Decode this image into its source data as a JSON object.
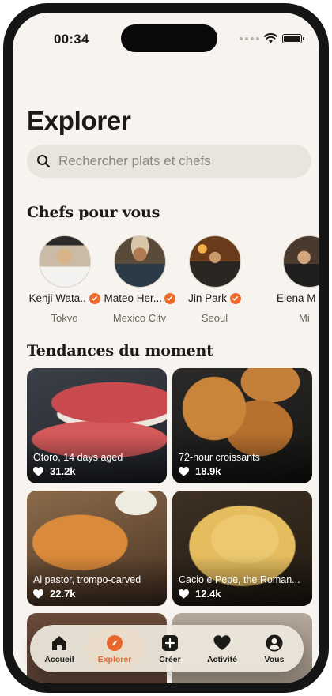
{
  "status_bar": {
    "time": "00:34"
  },
  "page": {
    "title": "Explorer"
  },
  "search": {
    "placeholder": "Rechercher plats et chefs"
  },
  "chefs_section": {
    "heading": "Chefs pour vous",
    "chefs": [
      {
        "name": "Kenji Wata...",
        "city": "Tokyo"
      },
      {
        "name": "Mateo Her...",
        "city": "Mexico City"
      },
      {
        "name": "Jin Park",
        "city": "Seoul"
      },
      {
        "name": "Elena M",
        "city": "Mi"
      }
    ]
  },
  "trending_section": {
    "heading": "Tendances du moment",
    "cards": [
      {
        "title": "Otoro, 14 days aged",
        "likes": "31.2k"
      },
      {
        "title": "72-hour croissants",
        "likes": "18.9k"
      },
      {
        "title": "Al pastor, trompo-carved",
        "likes": "22.7k"
      },
      {
        "title": "Cacio e Pepe, the Roman...",
        "likes": "12.4k"
      }
    ]
  },
  "tab_bar": {
    "tabs": [
      {
        "label": "Accueil",
        "icon": "home-icon"
      },
      {
        "label": "Explorer",
        "icon": "compass-icon",
        "active": true
      },
      {
        "label": "Créer",
        "icon": "plus-square-icon"
      },
      {
        "label": "Activité",
        "icon": "heart-icon"
      },
      {
        "label": "Vous",
        "icon": "profile-icon"
      }
    ]
  },
  "colors": {
    "accent": "#e8682b",
    "background": "#f7f4ef",
    "search_bg": "#e9e5de"
  }
}
